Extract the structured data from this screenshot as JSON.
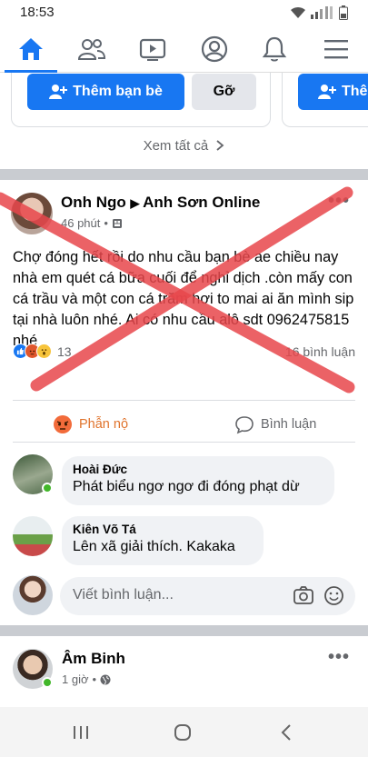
{
  "status": {
    "time": "18:53"
  },
  "nav": {
    "tabs": [
      "home",
      "friends",
      "watch",
      "profile",
      "notifications",
      "menu"
    ]
  },
  "suggest": {
    "add_label": "Thêm bạn bè",
    "remove_label": "Gỡ",
    "add_label_partial": "Thê",
    "see_all": "Xem tất cả"
  },
  "post": {
    "author": "Onh Ngo",
    "target": "Anh Sơn Online",
    "time": "46 phút",
    "body": "Chợ đóng hết rồi do nhu cầu bạn bè ae  chiều nay nhà em quét cá bữa cuối để nghỉ dịch .còn mấy con cá trầu và một con cá trăm hơi to mai ai ăn  mình sip tại nhà luôn nhé. Ai có nhu cầu alô sdt 0962475815 nhé",
    "reaction_count": "13",
    "comment_count": "16 bình luận",
    "action_react": "Phẫn nộ",
    "action_comment": "Bình luận",
    "more": "•••"
  },
  "comments": [
    {
      "name": "Hoài Đức",
      "text": "Phát biểu ngơ ngơ đi đóng phạt dừ"
    },
    {
      "name": "Kiên Võ Tá",
      "text": "Lên xã giải thích. Kakaka"
    }
  ],
  "composer": {
    "placeholder": "Viết bình luận..."
  },
  "post2": {
    "author": "Âm Binh",
    "time": "1 giờ"
  },
  "colors": {
    "brand": "#1877f2",
    "overlay_x": "#e8474c",
    "angry": "#e0732c"
  }
}
